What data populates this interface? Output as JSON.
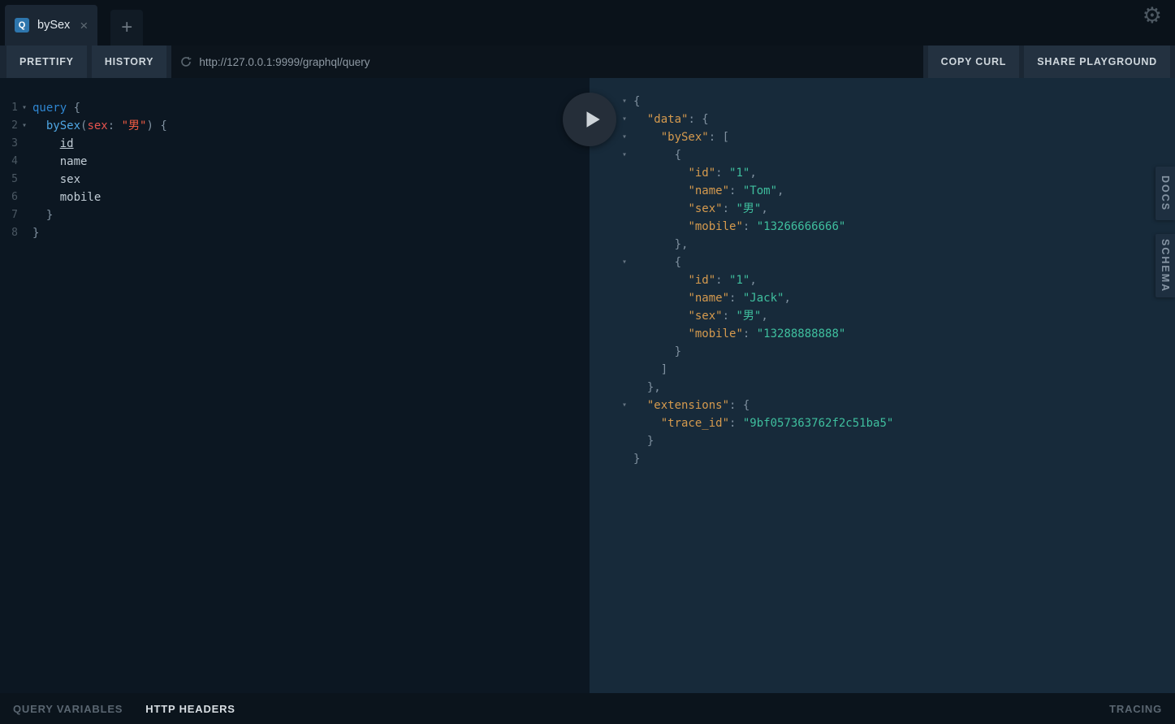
{
  "icons": {
    "settings": "⚙",
    "close": "×",
    "add": "+",
    "fold": "▾",
    "query_badge": "Q"
  },
  "colors": {
    "tab_badge_blue": "#2e76ad",
    "editor_background": "#0c1722",
    "result_background": "#172a3a",
    "keyword": "#2f86d1",
    "field": "#4fa6e3",
    "argument": "#e5534e",
    "query_string": "#ef5b43",
    "json_key": "#d59a4e",
    "json_string": "#3fbf9e"
  },
  "tab_bar": {
    "tab_title": "bySex"
  },
  "toolbar": {
    "prettify": "PRETTIFY",
    "history": "HISTORY",
    "url": "http://127.0.0.1:9999/graphql/query",
    "copy_curl": "COPY CURL",
    "share": "SHARE PLAYGROUND"
  },
  "editor": {
    "lines": [
      {
        "no": "1",
        "fold": true,
        "tokens": [
          {
            "t": "query",
            "c": "kw"
          },
          {
            "t": " {",
            "c": "pn"
          }
        ]
      },
      {
        "no": "2",
        "fold": true,
        "tokens": [
          {
            "t": "  ",
            "c": "pn"
          },
          {
            "t": "bySex",
            "c": "fld"
          },
          {
            "t": "(",
            "c": "pn"
          },
          {
            "t": "sex",
            "c": "arg"
          },
          {
            "t": ": ",
            "c": "pn"
          },
          {
            "t": "\"男\"",
            "c": "str"
          },
          {
            "t": ") {",
            "c": "pn"
          }
        ]
      },
      {
        "no": "3",
        "tokens": [
          {
            "t": "    ",
            "c": "pn"
          },
          {
            "t": "id",
            "c": "pl",
            "u": true
          }
        ]
      },
      {
        "no": "4",
        "tokens": [
          {
            "t": "    ",
            "c": "pn"
          },
          {
            "t": "name",
            "c": "pl"
          }
        ]
      },
      {
        "no": "5",
        "tokens": [
          {
            "t": "    ",
            "c": "pn"
          },
          {
            "t": "sex",
            "c": "pl"
          }
        ]
      },
      {
        "no": "6",
        "tokens": [
          {
            "t": "    ",
            "c": "pn"
          },
          {
            "t": "mobile",
            "c": "pl"
          }
        ]
      },
      {
        "no": "7",
        "tokens": [
          {
            "t": "  }",
            "c": "pn"
          }
        ]
      },
      {
        "no": "8",
        "tokens": [
          {
            "t": "}",
            "c": "pn"
          }
        ]
      }
    ]
  },
  "results": {
    "lines": [
      {
        "fold": true,
        "tokens": [
          {
            "t": "{",
            "c": "pn"
          }
        ]
      },
      {
        "fold": true,
        "tokens": [
          {
            "t": "  ",
            "c": "pn"
          },
          {
            "t": "\"data\"",
            "c": "rk"
          },
          {
            "t": ": {",
            "c": "pn"
          }
        ]
      },
      {
        "fold": true,
        "tokens": [
          {
            "t": "    ",
            "c": "pn"
          },
          {
            "t": "\"bySex\"",
            "c": "rk"
          },
          {
            "t": ": [",
            "c": "pn"
          }
        ]
      },
      {
        "fold": true,
        "tokens": [
          {
            "t": "      {",
            "c": "pn"
          }
        ]
      },
      {
        "tokens": [
          {
            "t": "        ",
            "c": "pn"
          },
          {
            "t": "\"id\"",
            "c": "rk"
          },
          {
            "t": ": ",
            "c": "pn"
          },
          {
            "t": "\"1\"",
            "c": "rs"
          },
          {
            "t": ",",
            "c": "pn"
          }
        ]
      },
      {
        "tokens": [
          {
            "t": "        ",
            "c": "pn"
          },
          {
            "t": "\"name\"",
            "c": "rk"
          },
          {
            "t": ": ",
            "c": "pn"
          },
          {
            "t": "\"Tom\"",
            "c": "rs"
          },
          {
            "t": ",",
            "c": "pn"
          }
        ]
      },
      {
        "tokens": [
          {
            "t": "        ",
            "c": "pn"
          },
          {
            "t": "\"sex\"",
            "c": "rk"
          },
          {
            "t": ": ",
            "c": "pn"
          },
          {
            "t": "\"男\"",
            "c": "rs"
          },
          {
            "t": ",",
            "c": "pn"
          }
        ]
      },
      {
        "tokens": [
          {
            "t": "        ",
            "c": "pn"
          },
          {
            "t": "\"mobile\"",
            "c": "rk"
          },
          {
            "t": ": ",
            "c": "pn"
          },
          {
            "t": "\"13266666666\"",
            "c": "rs"
          }
        ]
      },
      {
        "tokens": [
          {
            "t": "      },",
            "c": "pn"
          }
        ]
      },
      {
        "fold": true,
        "tokens": [
          {
            "t": "      {",
            "c": "pn"
          }
        ]
      },
      {
        "tokens": [
          {
            "t": "        ",
            "c": "pn"
          },
          {
            "t": "\"id\"",
            "c": "rk"
          },
          {
            "t": ": ",
            "c": "pn"
          },
          {
            "t": "\"1\"",
            "c": "rs"
          },
          {
            "t": ",",
            "c": "pn"
          }
        ]
      },
      {
        "tokens": [
          {
            "t": "        ",
            "c": "pn"
          },
          {
            "t": "\"name\"",
            "c": "rk"
          },
          {
            "t": ": ",
            "c": "pn"
          },
          {
            "t": "\"Jack\"",
            "c": "rs"
          },
          {
            "t": ",",
            "c": "pn"
          }
        ]
      },
      {
        "tokens": [
          {
            "t": "        ",
            "c": "pn"
          },
          {
            "t": "\"sex\"",
            "c": "rk"
          },
          {
            "t": ": ",
            "c": "pn"
          },
          {
            "t": "\"男\"",
            "c": "rs"
          },
          {
            "t": ",",
            "c": "pn"
          }
        ]
      },
      {
        "tokens": [
          {
            "t": "        ",
            "c": "pn"
          },
          {
            "t": "\"mobile\"",
            "c": "rk"
          },
          {
            "t": ": ",
            "c": "pn"
          },
          {
            "t": "\"13288888888\"",
            "c": "rs"
          }
        ]
      },
      {
        "tokens": [
          {
            "t": "      }",
            "c": "pn"
          }
        ]
      },
      {
        "tokens": [
          {
            "t": "    ]",
            "c": "pn"
          }
        ]
      },
      {
        "tokens": [
          {
            "t": "  },",
            "c": "pn"
          }
        ]
      },
      {
        "fold": true,
        "tokens": [
          {
            "t": "  ",
            "c": "pn"
          },
          {
            "t": "\"extensions\"",
            "c": "rk"
          },
          {
            "t": ": {",
            "c": "pn"
          }
        ]
      },
      {
        "tokens": [
          {
            "t": "    ",
            "c": "pn"
          },
          {
            "t": "\"trace_id\"",
            "c": "rk"
          },
          {
            "t": ": ",
            "c": "pn"
          },
          {
            "t": "\"9bf057363762f2c51ba5\"",
            "c": "rs"
          }
        ]
      },
      {
        "tokens": [
          {
            "t": "  }",
            "c": "pn"
          }
        ]
      },
      {
        "tokens": [
          {
            "t": "}",
            "c": "pn"
          }
        ]
      }
    ]
  },
  "side_tabs": {
    "docs": "DOCS",
    "schema": "SCHEMA"
  },
  "footer": {
    "query_variables": "QUERY VARIABLES",
    "http_headers": "HTTP HEADERS",
    "tracing": "TRACING"
  }
}
